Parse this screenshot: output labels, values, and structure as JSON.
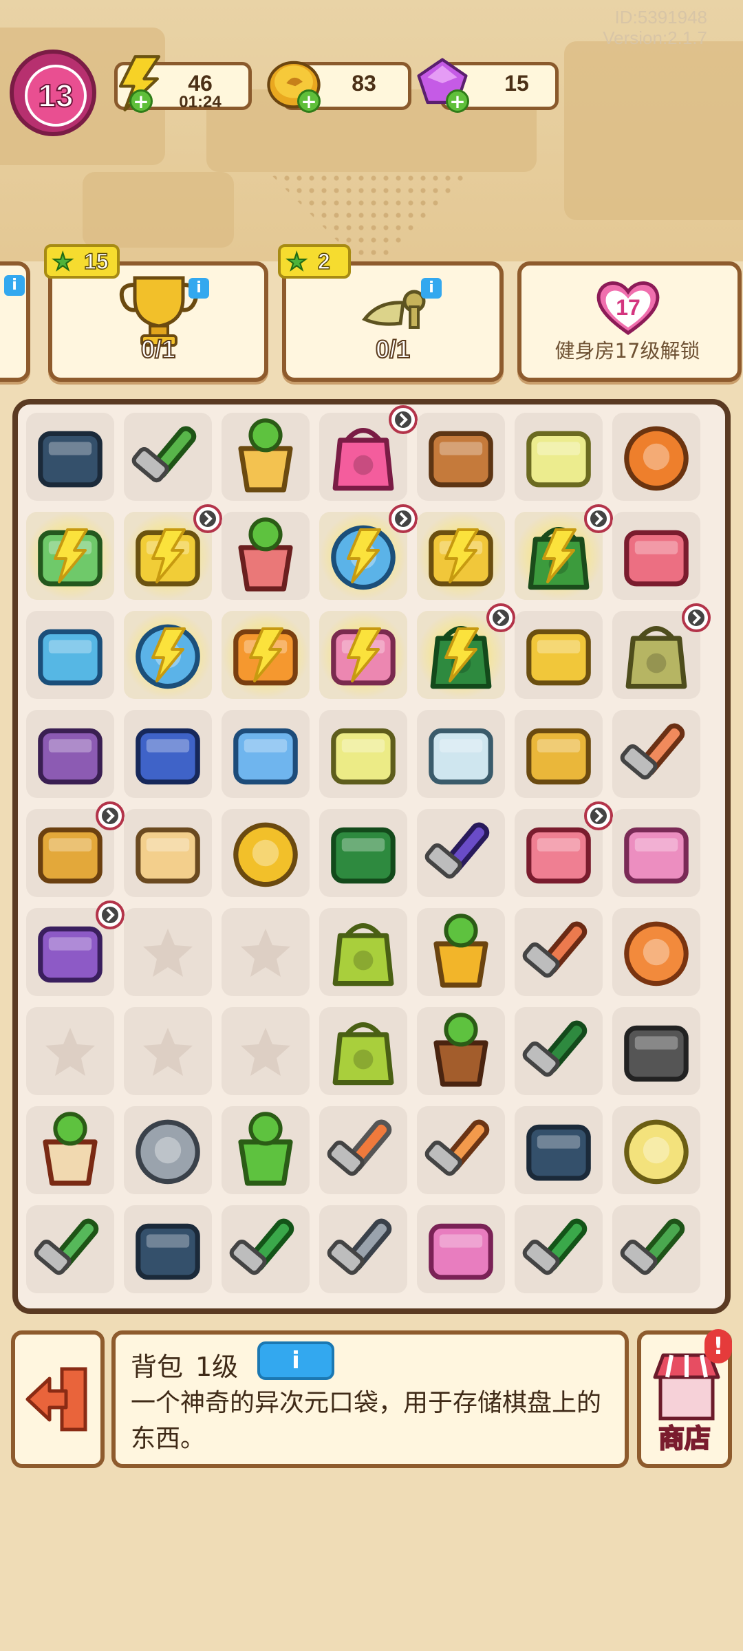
{
  "header": {
    "id_text": "ID:5391948",
    "version_text": "Version:2.1.7",
    "level": "13",
    "energy": {
      "value": "46",
      "timer": "01:24",
      "icon": "lightning-icon"
    },
    "coins": {
      "value": "83",
      "icon": "coin-icon"
    },
    "gems": {
      "value": "15",
      "icon": "gem-icon"
    }
  },
  "orders": [
    {
      "reward": "15",
      "progress": "0/1",
      "icon": "trophy-icon"
    },
    {
      "reward": "2",
      "progress": "0/1",
      "icon": "scroll-icon"
    }
  ],
  "unlock": {
    "level": "17",
    "text": "健身房17级解锁"
  },
  "board": {
    "cols": 7,
    "rows": 9,
    "items": [
      "cpu-chip",
      "megaphone",
      "plant-pot",
      "pink-backpack",
      "clay-chunks",
      "basket",
      "tape-measure",
      "retro-tv",
      "yellow-cart",
      "paint-bucket",
      "robot-vacuum",
      "shopping-cart",
      "green-bag",
      "pink-box",
      "blue-chips",
      "robot-vacuum",
      "orange-book",
      "brick-pile",
      "cash-bag",
      "shopping-cart",
      "seed-sack",
      "junk-pile",
      "blue-hood",
      "blue-book",
      "basket-weights",
      "chart-notepad",
      "yellow-cabinet",
      "mallet",
      "drawer-cabinet",
      "hamsters",
      "gold-coin",
      "green-lid",
      "purple-handle",
      "pink-dustpan",
      "pink-brick",
      "purple-box",
      "empty",
      "empty",
      "seed-bag",
      "gold-pot",
      "box-cutter",
      "apple-core",
      "empty",
      "empty",
      "empty",
      "seed-bag",
      "sprout-pot",
      "green-handle",
      "caster-wheel",
      "paint-can",
      "snail-shell",
      "tree-pot",
      "trowel",
      "pencil",
      "cpu-chip",
      "yarn-ball",
      "hacksaw",
      "cpu-chip",
      "drill-saw",
      "wrench",
      "pink-bricks",
      "pliers",
      "pipe"
    ]
  },
  "selected": {
    "name": "背包",
    "level": "1级",
    "info_label": "i",
    "description": "一个神奇的异次元口袋，用于存储棋盘上的东西。"
  },
  "shop": {
    "label": "商店",
    "alert": "!"
  }
}
